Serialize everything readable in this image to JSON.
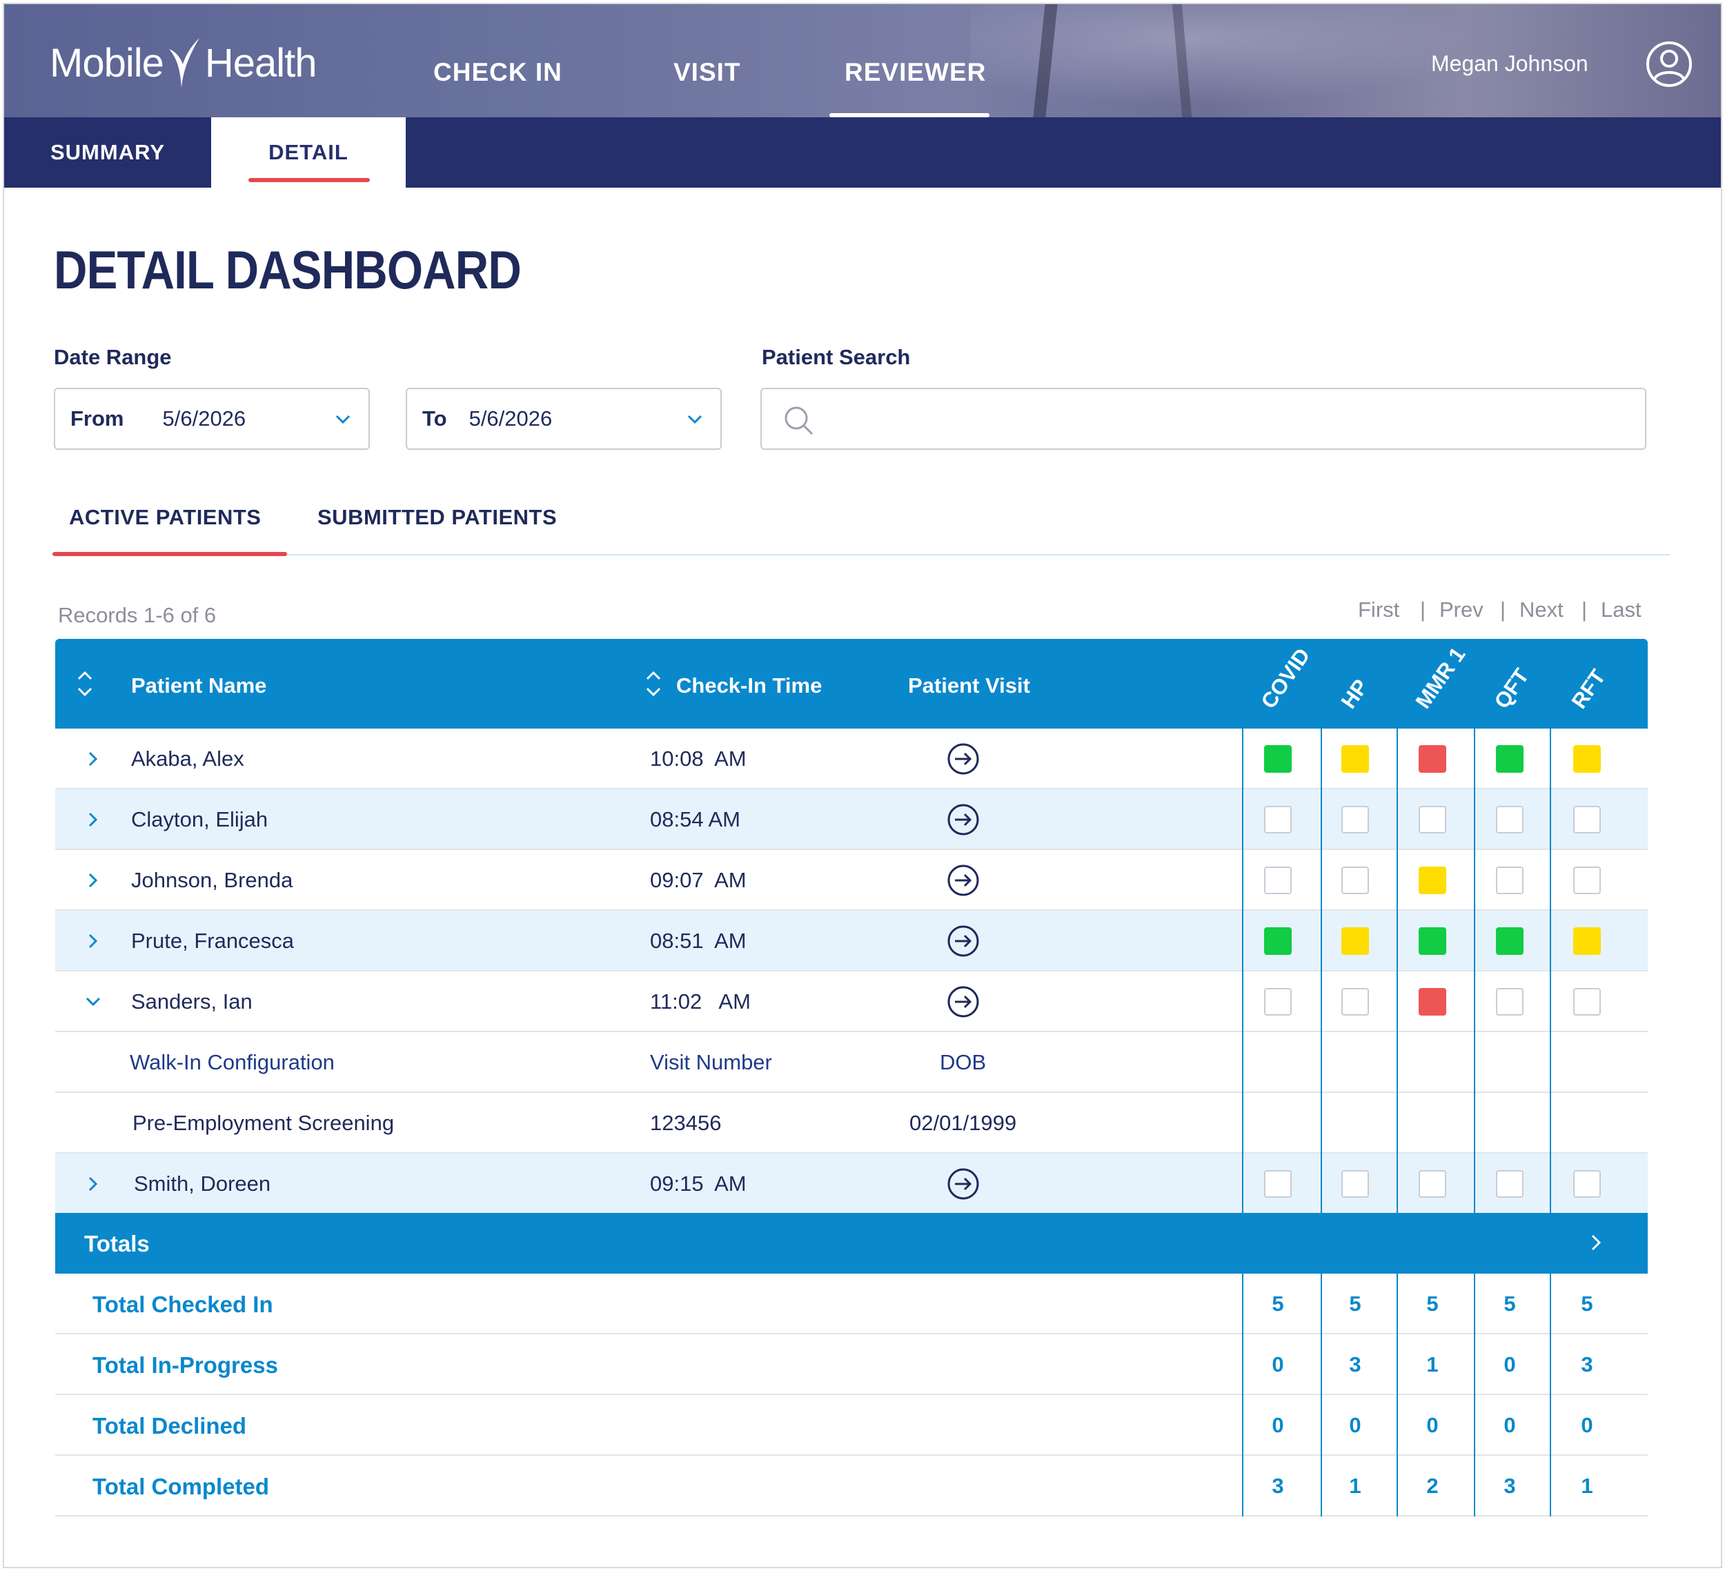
{
  "header": {
    "logo_text_left": "Mobile",
    "logo_text_right": "Health",
    "nav": [
      "CHECK IN",
      "VISIT",
      "REVIEWER"
    ],
    "active_nav": "REVIEWER",
    "user_name": "Megan Johnson"
  },
  "subnav": {
    "tabs": [
      "SUMMARY",
      "DETAIL"
    ],
    "active": "DETAIL"
  },
  "page_title": "DETAIL DASHBOARD",
  "filters": {
    "date_range_label": "Date Range",
    "from_label": "From",
    "from_value": "5/6/2026",
    "to_label": "To",
    "to_value": "5/6/2026",
    "patient_search_label": "Patient Search",
    "patient_search_value": ""
  },
  "patient_tabs": {
    "tabs": [
      "ACTIVE PATIENTS",
      "SUBMITTED PATIENTS"
    ],
    "active": "ACTIVE PATIENTS"
  },
  "records_text": "Records 1-6 of 6",
  "pager": {
    "first": "First",
    "prev": "Prev",
    "next": "Next",
    "last": "Last",
    "sep": "|"
  },
  "table": {
    "columns": {
      "patient_name": "Patient Name",
      "check_in_time": "Check-In Time",
      "patient_visit": "Patient Visit"
    },
    "tests": [
      "COVID",
      "HP",
      "MMR 1",
      "QFT",
      "RFT"
    ],
    "status_colors": {
      "green": "#11cc44",
      "yellow": "#ffdd00",
      "red": "#ee5555",
      "empty": "#ffffff"
    },
    "rows": [
      {
        "name": "Akaba, Alex",
        "time": "10:08  AM",
        "expanded": false,
        "status": [
          "green",
          "yellow",
          "red",
          "green",
          "yellow"
        ]
      },
      {
        "name": "Clayton, Elijah",
        "time": "08:54 AM",
        "expanded": false,
        "status": [
          "empty",
          "empty",
          "empty",
          "empty",
          "empty"
        ]
      },
      {
        "name": "Johnson, Brenda",
        "time": "09:07  AM",
        "expanded": false,
        "status": [
          "empty",
          "empty",
          "yellow",
          "empty",
          "empty"
        ]
      },
      {
        "name": "Prute, Francesca",
        "time": "08:51  AM",
        "expanded": false,
        "status": [
          "green",
          "yellow",
          "green",
          "green",
          "yellow"
        ]
      },
      {
        "name": "Sanders, Ian",
        "time": "11:02   AM",
        "expanded": true,
        "status": [
          "empty",
          "empty",
          "red",
          "empty",
          "empty"
        ]
      },
      {
        "name": "Smith, Doreen",
        "time": "09:15  AM",
        "expanded": false,
        "status": [
          "empty",
          "empty",
          "empty",
          "empty",
          "empty"
        ]
      }
    ],
    "expanded_detail": {
      "headers": [
        "Walk-In Configuration",
        "Visit Number",
        "DOB"
      ],
      "values": [
        "Pre-Employment Screening",
        "123456",
        "02/01/1999"
      ]
    }
  },
  "totals": {
    "label": "Totals",
    "rows": [
      {
        "label": "Total Checked In",
        "values": [
          "5",
          "5",
          "5",
          "5",
          "5"
        ]
      },
      {
        "label": "Total In-Progress",
        "values": [
          "0",
          "3",
          "1",
          "0",
          "3"
        ]
      },
      {
        "label": "Total Declined",
        "values": [
          "0",
          "0",
          "0",
          "0",
          "0"
        ]
      },
      {
        "label": "Total Completed",
        "values": [
          "3",
          "1",
          "2",
          "3",
          "1"
        ]
      }
    ]
  }
}
